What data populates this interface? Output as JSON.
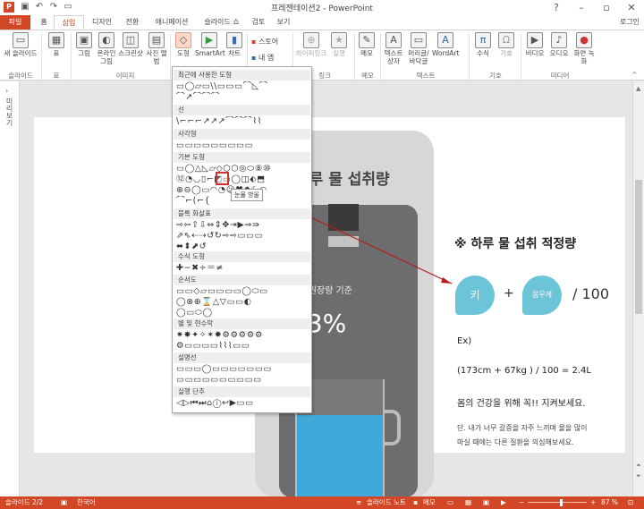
{
  "window": {
    "title": "프레젠테이션2 - PowerPoint",
    "qat_icons": [
      "ppt-logo-icon",
      "save-icon",
      "undo-icon",
      "redo-icon",
      "present-icon"
    ]
  },
  "tabs": [
    {
      "label": "파일"
    },
    {
      "label": "홈"
    },
    {
      "label": "삽입"
    },
    {
      "label": "디자인"
    },
    {
      "label": "전환"
    },
    {
      "label": "애니메이션"
    },
    {
      "label": "슬라이드 쇼"
    },
    {
      "label": "검토"
    },
    {
      "label": "보기"
    }
  ],
  "account": {
    "label": "로그인"
  },
  "ribbon": {
    "buttons": [
      {
        "label": "새 슬라이드",
        "icon": "▭"
      },
      {
        "label": "표",
        "icon": "▦"
      },
      {
        "label": "그림",
        "icon": "▣"
      },
      {
        "label": "온라인 그림",
        "icon": "◐"
      },
      {
        "label": "스크린샷",
        "icon": "◫"
      },
      {
        "label": "사진 앨범",
        "icon": "▤"
      },
      {
        "label": "도형",
        "icon": "◇"
      },
      {
        "label": "SmartArt",
        "icon": "▶"
      },
      {
        "label": "차트",
        "icon": "▮"
      },
      {
        "label": "스토어",
        "icon": "▪"
      },
      {
        "label": "내 앱",
        "icon": "▪"
      },
      {
        "label": "하이퍼링크",
        "icon": "⊕"
      },
      {
        "label": "실행",
        "icon": "★"
      },
      {
        "label": "메모",
        "icon": "✎"
      },
      {
        "label": "텍스트 상자",
        "icon": "A"
      },
      {
        "label": "머리글/바닥글",
        "icon": "▭"
      },
      {
        "label": "WordArt",
        "icon": "A"
      },
      {
        "label": "수식",
        "icon": "π"
      },
      {
        "label": "기호",
        "icon": "Ω"
      },
      {
        "label": "비디오",
        "icon": "▶"
      },
      {
        "label": "오디오",
        "icon": "♪"
      },
      {
        "label": "화면 녹화",
        "icon": "●"
      }
    ],
    "groups": [
      "슬라이드",
      "표",
      "이미지",
      "링크",
      "메모",
      "텍스트",
      "기호",
      "미디어"
    ]
  },
  "sidebar": {
    "label": "미리보기"
  },
  "shapes_panel": {
    "sections": [
      {
        "title": "최근에 사용한 도형",
        "rows": [
          "▭◯▱▭\\\\▭▭▭⌒◺⌒",
          "⌒↗⌒⌒⌒"
        ]
      },
      {
        "title": "선",
        "rows": [
          "\\⌐⌐⌐↗↗↗⌒⌒⌒⌇⌇"
        ]
      },
      {
        "title": "사각형",
        "rows": [
          "▭▭▭▭▭▭▭▭▭"
        ]
      },
      {
        "title": "기본 도형",
        "rows": [
          "▭◯△◺▱◇⬡⬡◎⬭⑧⑩",
          "⑫◔◡▯⌐◩▭◯◫⬖⬒",
          "⊕⊖◯▭◠◔☺♥✹☾◠",
          "⌒⌐(⌐{"
        ]
      },
      {
        "title": "블록 화살표",
        "rows": [
          "⇨⇦⇧⇩⇔⇕✥⇥▶⇒⇛",
          "⇗⇖⇠⇢↺↻⇨⇨▭▭▭",
          "⬌⬍⬈↺"
        ]
      },
      {
        "title": "수식 도형",
        "rows": [
          "✚−✖÷＝≠"
        ]
      },
      {
        "title": "순서도",
        "rows": [
          "▭▭◇▱▭▭▭▭◯⬭▭",
          "◯⊗⊕⌛△▽▭▭◐",
          "◯▭⬭◯"
        ]
      },
      {
        "title": "별 및 현수막",
        "rows": [
          "✷✸✦✧✶✹⚙⚙⚙⚙⚙",
          "⚙▭▭▭▭⌇⌇⌇▭▭"
        ]
      },
      {
        "title": "설명선",
        "rows": [
          "▭▭▭◯▭▭▭▭▭▭▭",
          "▭▭▭▭▭▭▭▭▭▭"
        ]
      },
      {
        "title": "실행 단추",
        "rows": [
          "◁▷⏮⏭⌂ⓘ↩▶▭▭"
        ]
      }
    ],
    "tooltip": "눈물 방울"
  },
  "slide": {
    "title": "하루 물 섭취량",
    "goal_text": "1일 권장량 기준",
    "percent": "63%",
    "water_level": 0.7,
    "heading": "※ 하루 물 섭취 적정량",
    "bubble1": "키",
    "plus": "+",
    "bubble2": "몸무게",
    "div": "/ 100",
    "ex": "Ex)",
    "formula": "(173cm + 67kg ) / 100 = 2.4L",
    "health": "몸의 건강을 위해 꼭!! 지켜보세요.",
    "note1": "단. 내가 너무 갈증을 자주 느끼며 물을 많이",
    "note2": "마실 때에는 다른 질환을 의심해보세요."
  },
  "status": {
    "slide_num": "슬라이드 2/2",
    "language": "한국어",
    "notes": "슬라이드 노트",
    "comments": "메모",
    "zoom": "87 %"
  },
  "colors": {
    "accent": "#d24726",
    "bubble": "#6cc4d8",
    "water": "#3fa9d9",
    "callout": "#cc2222"
  }
}
